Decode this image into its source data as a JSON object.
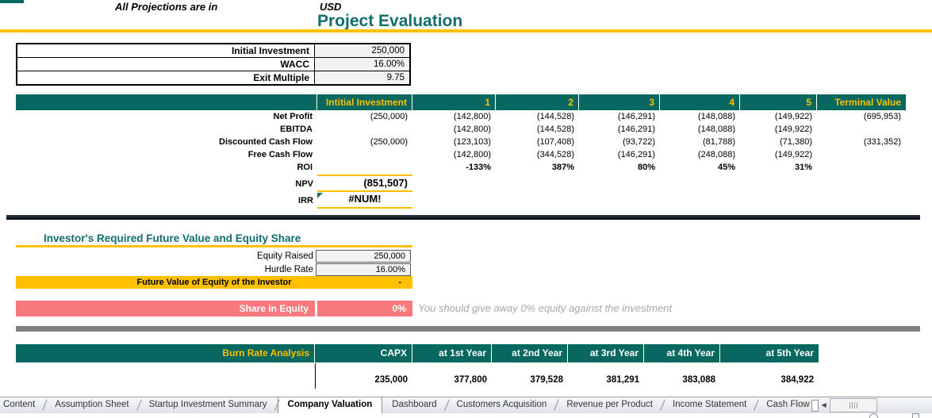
{
  "header": {
    "projections_label": "All Projections are in",
    "currency": "USD",
    "title": "Project Evaluation"
  },
  "inputs": {
    "rows": [
      {
        "label": "Initial Investment",
        "value": "250,000"
      },
      {
        "label": "WACC",
        "value": "16.00%"
      },
      {
        "label": "Exit Multiple",
        "value": "9.75"
      }
    ]
  },
  "projection_table": {
    "col_headers": {
      "initial": "Intitial Investment",
      "years": [
        "1",
        "2",
        "3",
        "4",
        "5"
      ],
      "terminal": "Terminal Value"
    },
    "rows": [
      {
        "label": "Net Profit",
        "initial": "(250,000)",
        "years": [
          "(142,800)",
          "(144,528)",
          "(146,291)",
          "(148,088)",
          "(149,922)"
        ],
        "terminal": "(695,953)"
      },
      {
        "label": "EBITDA",
        "initial": "",
        "years": [
          "(142,800)",
          "(144,528)",
          "(146,291)",
          "(148,088)",
          "(149,922)"
        ],
        "terminal": ""
      },
      {
        "label": "Discounted Cash Flow",
        "initial": "(250,000)",
        "years": [
          "(123,103)",
          "(107,408)",
          "(93,722)",
          "(81,788)",
          "(71,380)"
        ],
        "terminal": "(331,352)"
      },
      {
        "label": "Free Cash Flow",
        "initial": "",
        "years": [
          "(142,800)",
          "(344,528)",
          "(146,291)",
          "(248,088)",
          "(149,922)"
        ],
        "terminal": ""
      },
      {
        "label": "ROI",
        "initial": "",
        "years": [
          "-133%",
          "387%",
          "80%",
          "45%",
          "31%"
        ],
        "terminal": ""
      }
    ],
    "npv": {
      "label": "NPV",
      "value": "(851,507)"
    },
    "irr": {
      "label": "IRR",
      "value": "#NUM!"
    }
  },
  "investor_section": {
    "title": "Investor's Required Future Value and Equity Share",
    "rows": [
      {
        "label": "Equity Raised",
        "value": "250,000"
      },
      {
        "label": "Hurdle Rate",
        "value": "16.00%"
      }
    ],
    "future_value": {
      "label": "Future Value of Equity of the Investor",
      "value": "-"
    },
    "share": {
      "label": "Share in Equity",
      "value": "0%",
      "note": "You should give away 0% equity against the investment"
    }
  },
  "burn_rate": {
    "title": "Burn Rate Analysis",
    "col_headers": [
      "CAPX",
      "at 1st Year",
      "at 2nd Year",
      "at 3rd Year",
      "at 4th Year",
      "at 5th Year"
    ],
    "values": [
      "235,000",
      "377,800",
      "379,528",
      "381,291",
      "383,088",
      "384,922"
    ]
  },
  "sheet_tabs": {
    "tabs": [
      "Content",
      "Assumption Sheet",
      "Startup Investment Summary",
      "Company Valuation",
      "Dashboard",
      "Customers Acquisition",
      "Revenue per Product",
      "Income Statement",
      "Cash Flow"
    ],
    "active": "Company Valuation"
  },
  "colors": {
    "table_header_teal": "#06685E",
    "title_teal": "#116E70",
    "accent_gold": "#FFC000",
    "share_salmon": "#F8797B",
    "input_fill_gray": "#F2F2F2",
    "note_gray": "#A8A8A8"
  }
}
